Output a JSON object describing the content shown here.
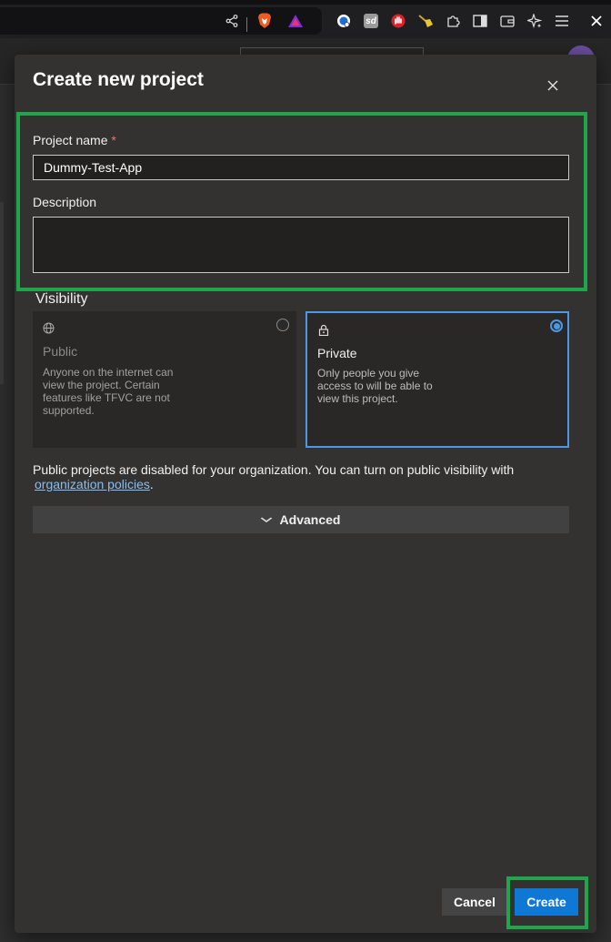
{
  "browser": {
    "toolbar_icons": [
      "share-icon",
      "brave-lion-icon",
      "triangle-rewards-icon",
      "extension-1-icon",
      "sd-extension-icon",
      "stop-hand-icon",
      "broom-icon",
      "puzzle-icon",
      "sidebar-icon",
      "wallet-icon",
      "ai-sparkle-icon",
      "menu-icon",
      "close-window-icon"
    ]
  },
  "dialog": {
    "title": "Create new project",
    "close_glyph": "✕",
    "project_name_label": "Project name",
    "required_marker": "*",
    "project_name_value": "Dummy-Test-App",
    "description_label": "Description",
    "description_value": "",
    "visibility_label": "Visibility",
    "visibility_options": [
      {
        "title": "Public",
        "description": "Anyone on the internet can view the project. Certain features like TFVC are not supported.",
        "selected": false,
        "icon": "globe-icon"
      },
      {
        "title": "Private",
        "description": "Only people you give access to will be able to view this project.",
        "selected": true,
        "icon": "lock-icon"
      }
    ],
    "note_text": "Public projects are disabled for your organization. You can turn on public visibility with",
    "note_link": "organization policies",
    "note_end": ".",
    "advanced_label": "Advanced",
    "cancel_label": "Cancel",
    "create_label": "Create"
  },
  "colors": {
    "accent_blue": "#0f78d4",
    "selection_border": "#4d98e6",
    "highlight_green": "#1fa64a",
    "required_red": "#f1707b"
  }
}
